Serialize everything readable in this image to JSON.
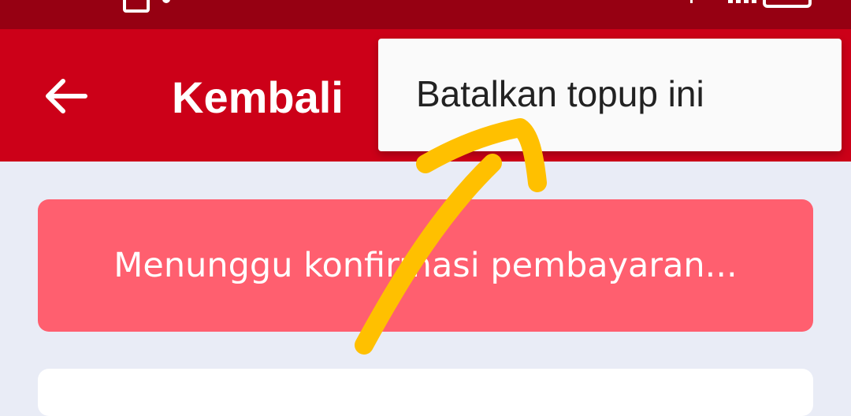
{
  "app_bar": {
    "title": "Kembali",
    "back_icon": "arrow-left-icon",
    "background_color": "#cc0018"
  },
  "status_bar": {
    "background_color": "#960012"
  },
  "popup_menu": {
    "items": [
      {
        "label": "Batalkan topup ini"
      }
    ]
  },
  "status_card": {
    "text": "Menunggu konfirmasi pembayaran...",
    "background_color": "#ff5f6f"
  },
  "annotation": {
    "color": "#ffc000",
    "icon": "hand-drawn-arrow-icon"
  }
}
